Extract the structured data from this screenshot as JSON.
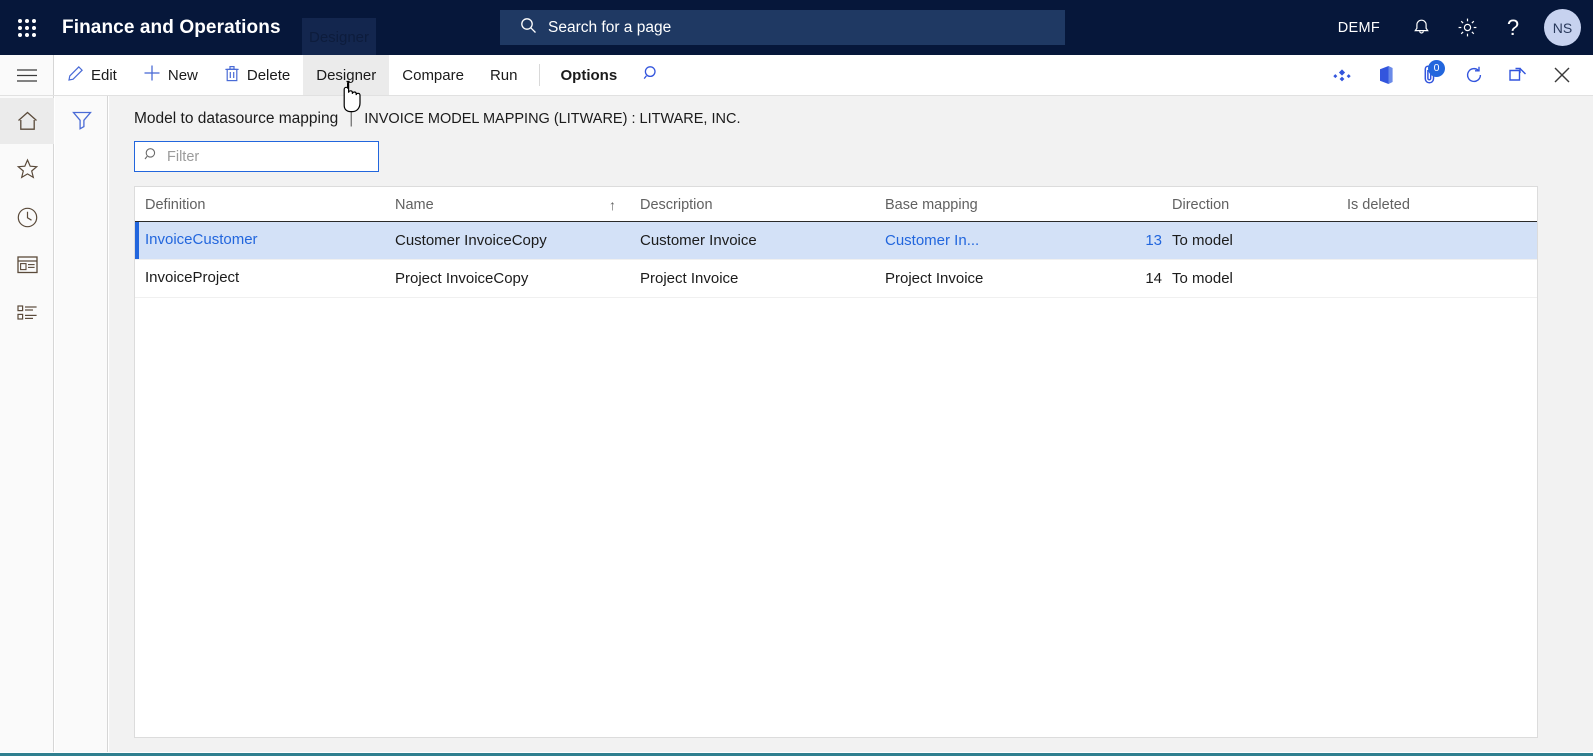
{
  "navbar": {
    "waffle_icon": "app-launcher-icon",
    "app_title": "Finance and Operations",
    "ghost_tooltip": "Designer",
    "search": {
      "placeholder": "Search for a page",
      "icon": "search-icon"
    },
    "company": "DEMF",
    "notifications_icon": "bell-icon",
    "settings_icon": "gear-icon",
    "help_icon": "question-mark-icon",
    "avatar_initials": "NS"
  },
  "commandbar": {
    "hamburger_icon": "hamburger-menu-icon",
    "buttons": [
      {
        "label": "Edit",
        "icon": "pencil-icon",
        "bold": false,
        "hovered": false
      },
      {
        "label": "New",
        "icon": "plus-icon",
        "bold": false,
        "hovered": false
      },
      {
        "label": "Delete",
        "icon": "trash-icon",
        "bold": false,
        "hovered": false
      },
      {
        "label": "Designer",
        "icon": "",
        "bold": false,
        "hovered": true
      },
      {
        "label": "Compare",
        "icon": "",
        "bold": false,
        "hovered": false
      },
      {
        "label": "Run",
        "icon": "",
        "bold": false,
        "hovered": false
      },
      {
        "label": "Options",
        "icon": "",
        "bold": true,
        "hovered": false
      }
    ],
    "search_icon": "search-icon",
    "right_icons": [
      {
        "name": "share-diamond-icon"
      },
      {
        "name": "office-app-icon"
      },
      {
        "name": "attachments-icon",
        "badge": "0"
      },
      {
        "name": "refresh-icon"
      },
      {
        "name": "popout-icon"
      },
      {
        "name": "close-icon"
      }
    ]
  },
  "rail": {
    "items": [
      {
        "name": "sidebar-item-home",
        "icon": "home-icon",
        "active": true
      },
      {
        "name": "sidebar-item-favorites",
        "icon": "star-icon",
        "active": false
      },
      {
        "name": "sidebar-item-recent",
        "icon": "clock-icon",
        "active": false
      },
      {
        "name": "sidebar-item-workspaces",
        "icon": "workspace-icon",
        "active": false
      },
      {
        "name": "sidebar-item-modules",
        "icon": "modules-list-icon",
        "active": false
      }
    ]
  },
  "filterpane": {
    "icon": "filter-funnel-icon"
  },
  "page": {
    "title": "Model to datasource mapping",
    "separator": "|",
    "context": "INVOICE MODEL MAPPING (LITWARE) : LITWARE, INC.",
    "filter": {
      "placeholder": "Filter",
      "value": "",
      "icon": "search-icon"
    }
  },
  "grid": {
    "columns": [
      {
        "key": "definition",
        "label": "Definition",
        "sorted": ""
      },
      {
        "key": "name",
        "label": "Name",
        "sorted": "asc",
        "sort_glyph": "↑"
      },
      {
        "key": "description",
        "label": "Description",
        "sorted": ""
      },
      {
        "key": "base_mapping",
        "label": "Base mapping",
        "sorted": ""
      },
      {
        "key": "number",
        "label": "",
        "sorted": ""
      },
      {
        "key": "direction",
        "label": "Direction",
        "sorted": ""
      },
      {
        "key": "is_deleted",
        "label": "Is deleted",
        "sorted": ""
      }
    ],
    "rows": [
      {
        "definition": "InvoiceCustomer",
        "name": "Customer InvoiceCopy",
        "description": "Customer Invoice",
        "base_mapping": "Customer In...",
        "number": "13",
        "direction": "To model",
        "is_deleted": "",
        "selected": true
      },
      {
        "definition": "InvoiceProject",
        "name": "Project InvoiceCopy",
        "description": "Project Invoice",
        "base_mapping": "Project Invoice",
        "number": "14",
        "direction": "To model",
        "is_deleted": "",
        "selected": false
      }
    ]
  },
  "colors": {
    "nav_background": "#06173a",
    "accent": "#2266dd",
    "selection_row": "#d3e1f7",
    "hover": "#ebebeb",
    "bottom_rule": "#2f7f8f"
  }
}
